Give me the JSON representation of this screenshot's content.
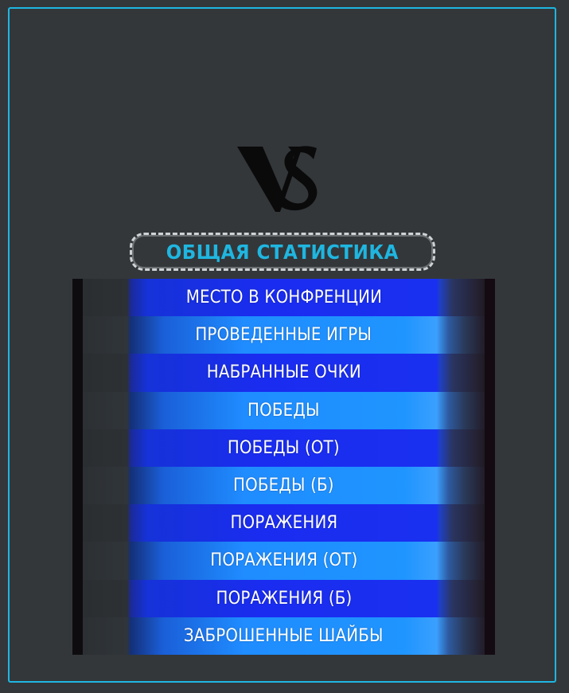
{
  "logo": {
    "icon": "vs-logo-icon",
    "text": "VS"
  },
  "title": "ОБЩАЯ СТАТИСТИКА",
  "stats": [
    {
      "label": "МЕСТО В КОНФРЕНЦИИ"
    },
    {
      "label": "ПРОВЕДЕННЫЕ ИГРЫ"
    },
    {
      "label": "НАБРАННЫЕ ОЧКИ"
    },
    {
      "label": "ПОБЕДЫ"
    },
    {
      "label": "ПОБЕДЫ (ОТ)"
    },
    {
      "label": "ПОБЕДЫ (Б)"
    },
    {
      "label": "ПОРАЖЕНИЯ"
    },
    {
      "label": "ПОРАЖЕНИЯ (ОТ)"
    },
    {
      "label": "ПОРАЖЕНИЯ (Б)"
    },
    {
      "label": "ЗАБРОШЕННЫЕ ШАЙБЫ"
    }
  ],
  "colors": {
    "background": "#33373a",
    "accent": "#1fb6e0",
    "row_dark": "#1a2cf0",
    "row_light": "#1f95ff",
    "text": "#ffffff"
  }
}
